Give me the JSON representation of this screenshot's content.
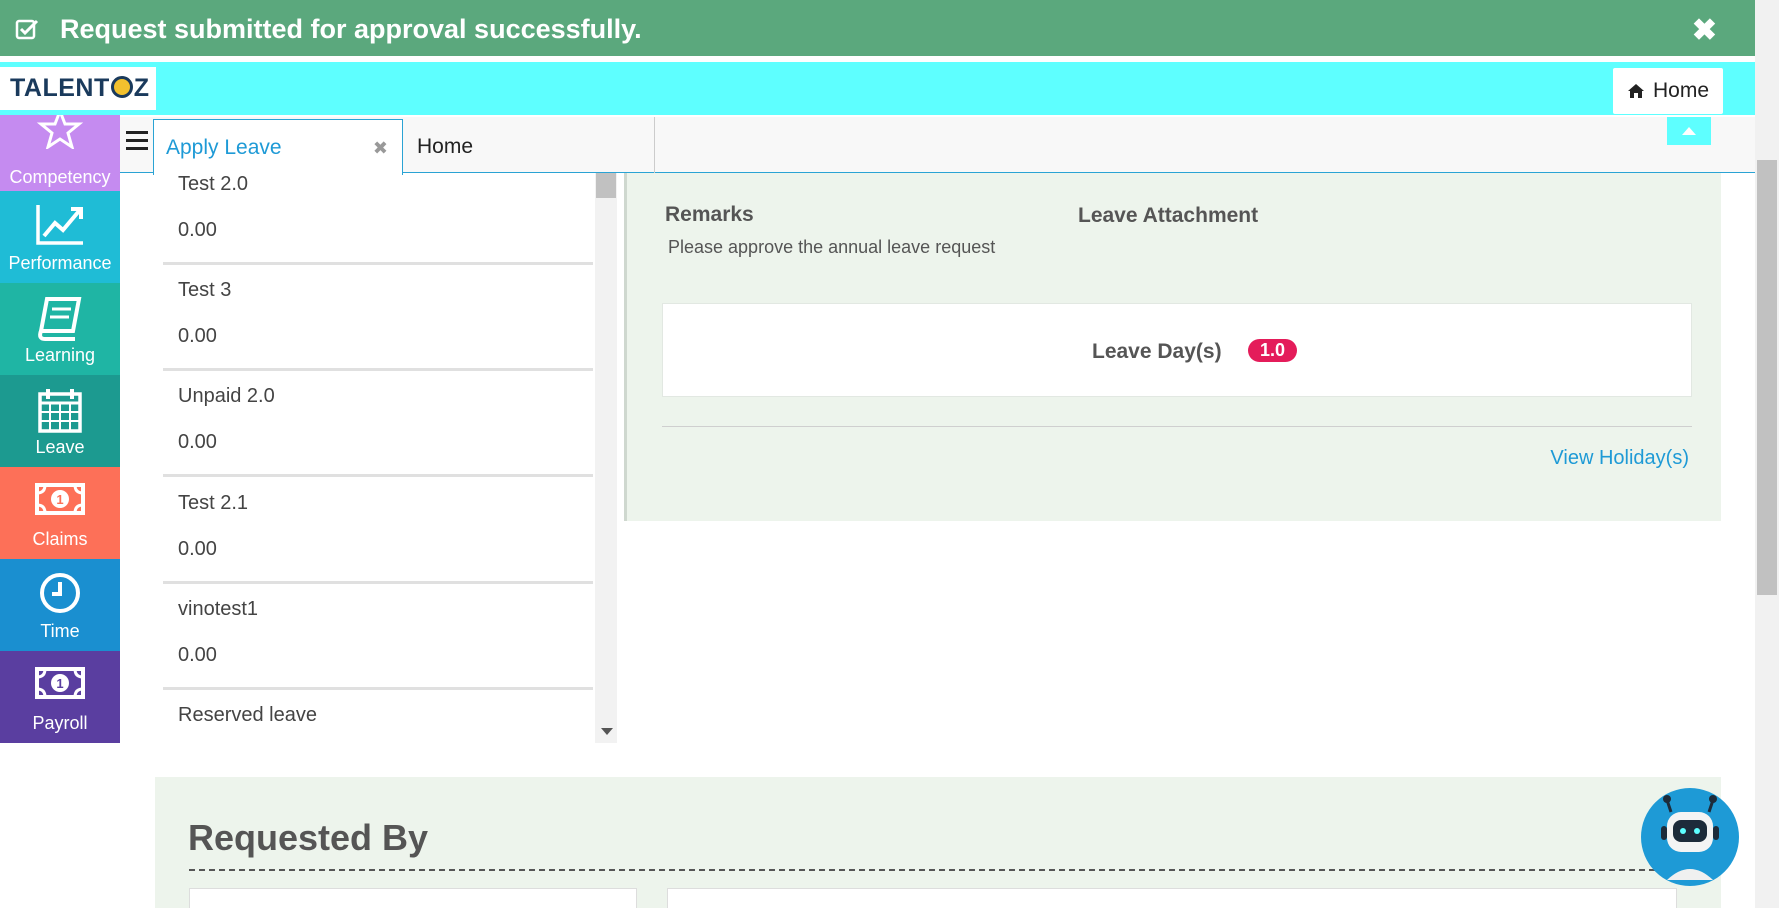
{
  "toast": {
    "message": "Request submitted for approval successfully.",
    "close_label": "✖"
  },
  "header": {
    "logo_left": "TALENT",
    "logo_right": "Z",
    "home_label": "Home"
  },
  "tabs": {
    "active_label": "Apply Leave",
    "close_glyph": "✖",
    "home_label": "Home"
  },
  "sidenav": {
    "items": [
      {
        "label": "Competency",
        "color": "#c58bf0"
      },
      {
        "label": "Performance",
        "color": "#1fbcd6"
      },
      {
        "label": "Learning",
        "color": "#1fb5a4"
      },
      {
        "label": "Leave",
        "color": "#1c9a90"
      },
      {
        "label": "Claims",
        "color": "#fd7058"
      },
      {
        "label": "Time",
        "color": "#1a8fd0"
      },
      {
        "label": "Payroll",
        "color": "#5a3ea0"
      }
    ]
  },
  "leave_list": [
    {
      "name": "Test 2.0",
      "value": "0.00"
    },
    {
      "name": "Test 3",
      "value": "0.00"
    },
    {
      "name": "Unpaid 2.0",
      "value": "0.00"
    },
    {
      "name": "Test 2.1",
      "value": "0.00"
    },
    {
      "name": "vinotest1",
      "value": "0.00"
    },
    {
      "name": "Reserved leave",
      "value": ""
    }
  ],
  "detail": {
    "remarks_heading": "Remarks",
    "remarks_text": "Please approve the annual leave request",
    "attachment_heading": "Leave Attachment",
    "leave_days_label": "Leave Day(s)",
    "leave_days_value": "1.0",
    "holiday_link": "View Holiday(s)"
  },
  "requested_by": {
    "title": "Requested By"
  },
  "colors": {
    "toast": "#5ba87d",
    "header": "#5effff",
    "accent": "#1e9ad6",
    "badge": "#e41c5a"
  }
}
